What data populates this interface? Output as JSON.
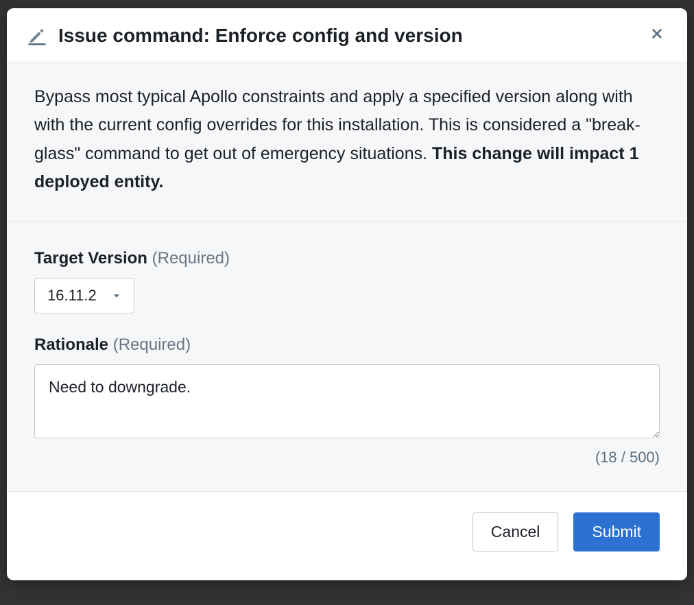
{
  "header": {
    "title": "Issue command: Enforce config and version"
  },
  "description": {
    "text": "Bypass most typical Apollo constraints and apply a specified version along with with the current config overrides for this installation. This is considered a \"break-glass\" command to get out of emergency situations. ",
    "bold_text": "This change will impact 1 deployed entity."
  },
  "fields": {
    "target_version": {
      "label": "Target Version",
      "required_text": "(Required)",
      "value": "16.11.2"
    },
    "rationale": {
      "label": "Rationale",
      "required_text": "(Required)",
      "value": "Need to downgrade.",
      "char_count": "(18 / 500)"
    }
  },
  "footer": {
    "cancel_label": "Cancel",
    "submit_label": "Submit"
  }
}
